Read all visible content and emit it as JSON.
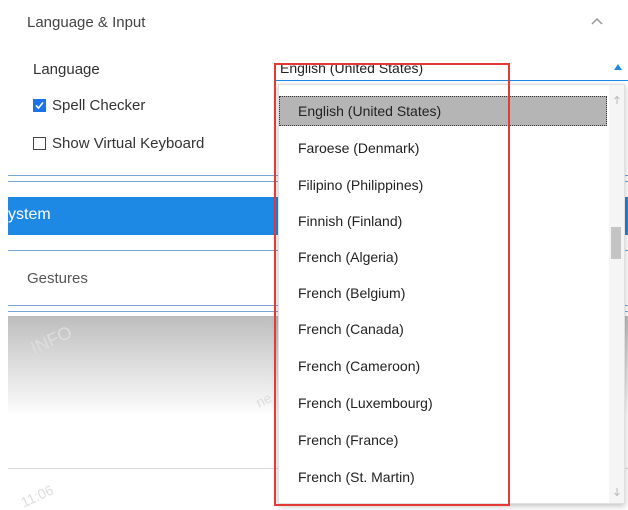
{
  "section": {
    "title": "Language & Input"
  },
  "language": {
    "label": "Language",
    "value": "English (United States)"
  },
  "spell_checker": {
    "label": "Spell Checker",
    "checked": true
  },
  "virtual_keyboard": {
    "label": "Show Virtual Keyboard",
    "checked": false
  },
  "system": {
    "label": "ystem"
  },
  "gestures": {
    "label": "Gestures"
  },
  "dropdown": {
    "options": [
      "English (United States)",
      "Faroese (Denmark)",
      "Filipino (Philippines)",
      "Finnish (Finland)",
      "French (Algeria)",
      "French (Belgium)",
      "French (Canada)",
      "French (Cameroon)",
      "French (Luxembourg)",
      "French (France)",
      "French (St. Martin)"
    ],
    "selected_index": 0
  },
  "watermarks": [
    "INFO",
    "ne",
    "11:06"
  ],
  "colors": {
    "accent": "#1e88e5",
    "highlight": "#e53935",
    "selection": "#b5b5b5"
  }
}
